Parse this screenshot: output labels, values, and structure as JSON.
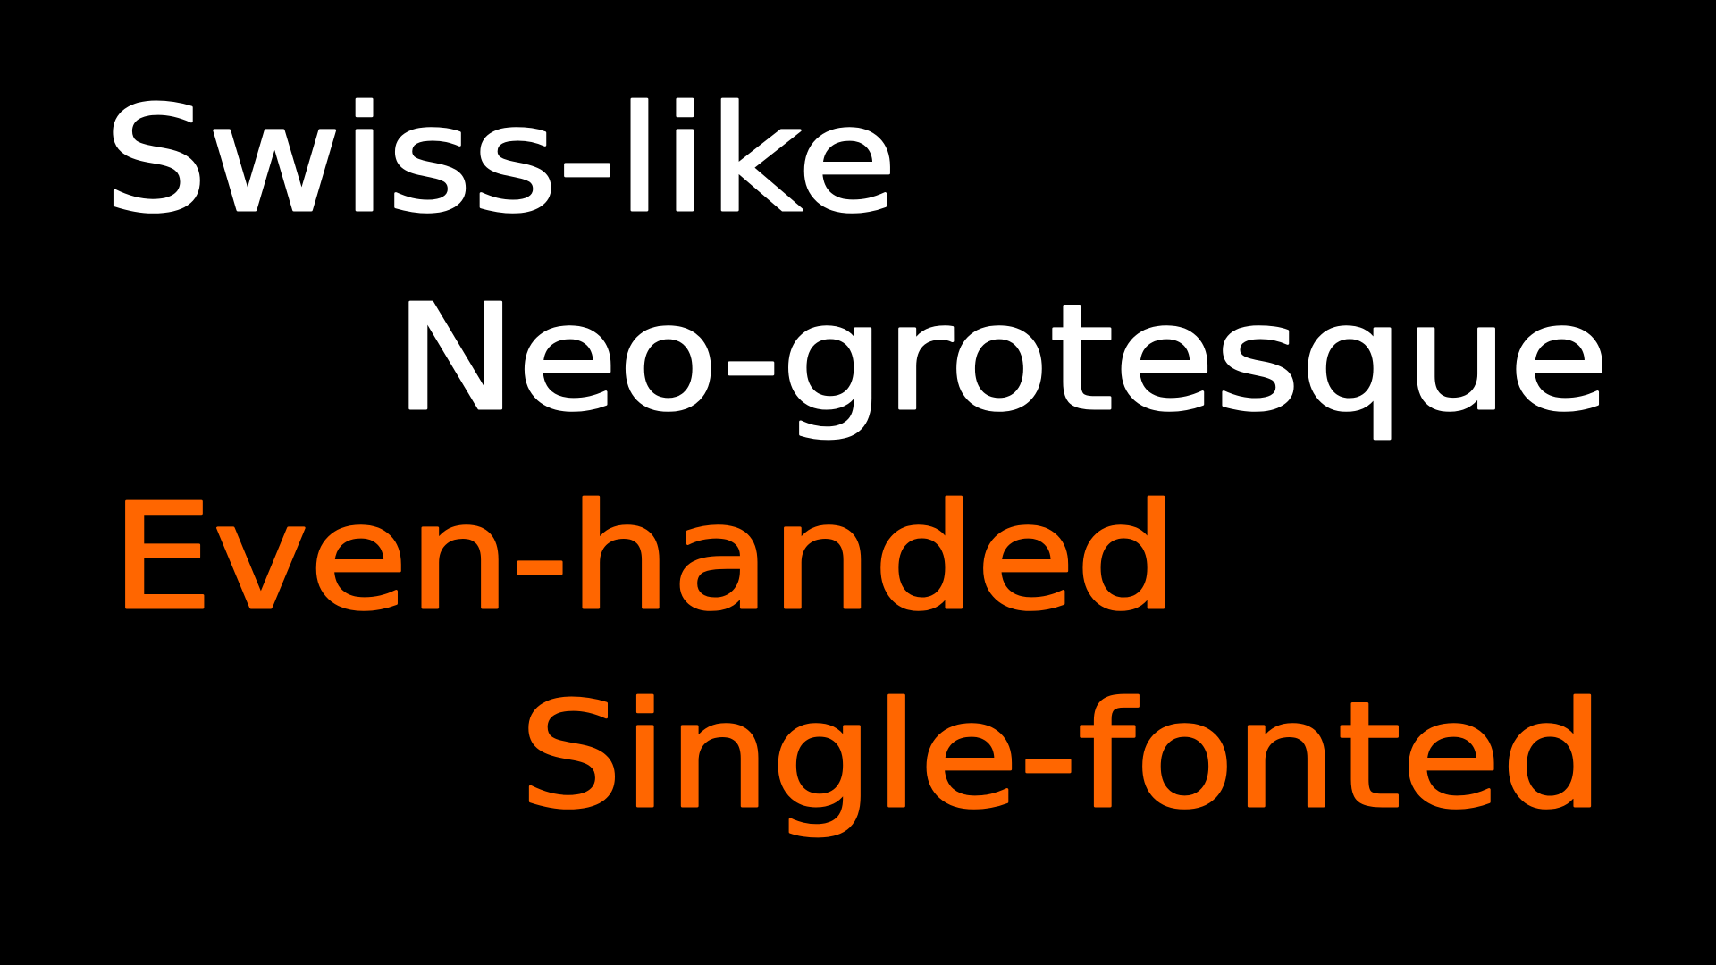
{
  "colors": {
    "background": "#000000",
    "primary_text": "#FFFFFF",
    "accent_text": "#FF6600"
  },
  "lines": [
    {
      "text": "Swiss-like",
      "color": "#FFFFFF"
    },
    {
      "text": "Neo-grotesque",
      "color": "#FFFFFF"
    },
    {
      "text": "Even-handed",
      "color": "#FF6600"
    },
    {
      "text": "Single-fonted",
      "color": "#FF6600"
    }
  ]
}
